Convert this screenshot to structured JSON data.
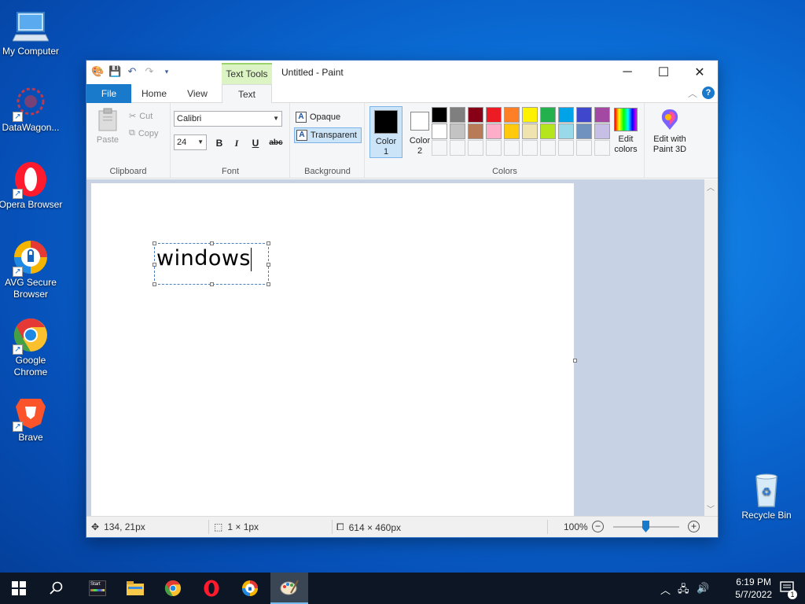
{
  "desktop": {
    "icons": [
      {
        "label": "My Computer"
      },
      {
        "label": "DataWagon..."
      },
      {
        "label": "Opera Browser"
      },
      {
        "label": "AVG Secure Browser"
      },
      {
        "label": "Google Chrome"
      },
      {
        "label": "Brave"
      },
      {
        "label": "Recycle Bin"
      }
    ]
  },
  "window": {
    "title": "Untitled - Paint",
    "context_tab": "Text Tools",
    "tabs": {
      "file": "File",
      "home": "Home",
      "view": "View",
      "text": "Text"
    },
    "help": "?"
  },
  "ribbon": {
    "clipboard": {
      "paste": "Paste",
      "cut": "Cut",
      "copy": "Copy",
      "label": "Clipboard"
    },
    "font": {
      "family": "Calibri",
      "size": "24",
      "bold": "B",
      "italic": "I",
      "underline": "U",
      "strike": "abc",
      "label": "Font"
    },
    "background": {
      "opaque": "Opaque",
      "transparent": "Transparent",
      "label": "Background"
    },
    "colors": {
      "color1": "Color 1",
      "color2": "Color 2",
      "label": "Colors",
      "edit": "Edit colors",
      "paint3d": "Edit with Paint 3D",
      "color1_value": "#000000",
      "color2_value": "#ffffff",
      "palette_row1": [
        "#000000",
        "#7f7f7f",
        "#880015",
        "#ed1c24",
        "#ff7f27",
        "#fff200",
        "#22b14c",
        "#00a2e8",
        "#3f48cc",
        "#a349a4"
      ],
      "palette_row2": [
        "#ffffff",
        "#c3c3c3",
        "#b97a57",
        "#ffaec9",
        "#ffc90e",
        "#efe4b0",
        "#b5e61d",
        "#99d9ea",
        "#7092be",
        "#c8bfe7"
      ]
    }
  },
  "canvas": {
    "text": "windows"
  },
  "status": {
    "cursor": "134, 21px",
    "selection": "1 × 1px",
    "size": "614 × 460px",
    "zoom": "100%"
  },
  "taskbar": {
    "time": "6:19 PM",
    "date": "5/7/2022",
    "start_label": "Start",
    "notif_count": "1"
  }
}
